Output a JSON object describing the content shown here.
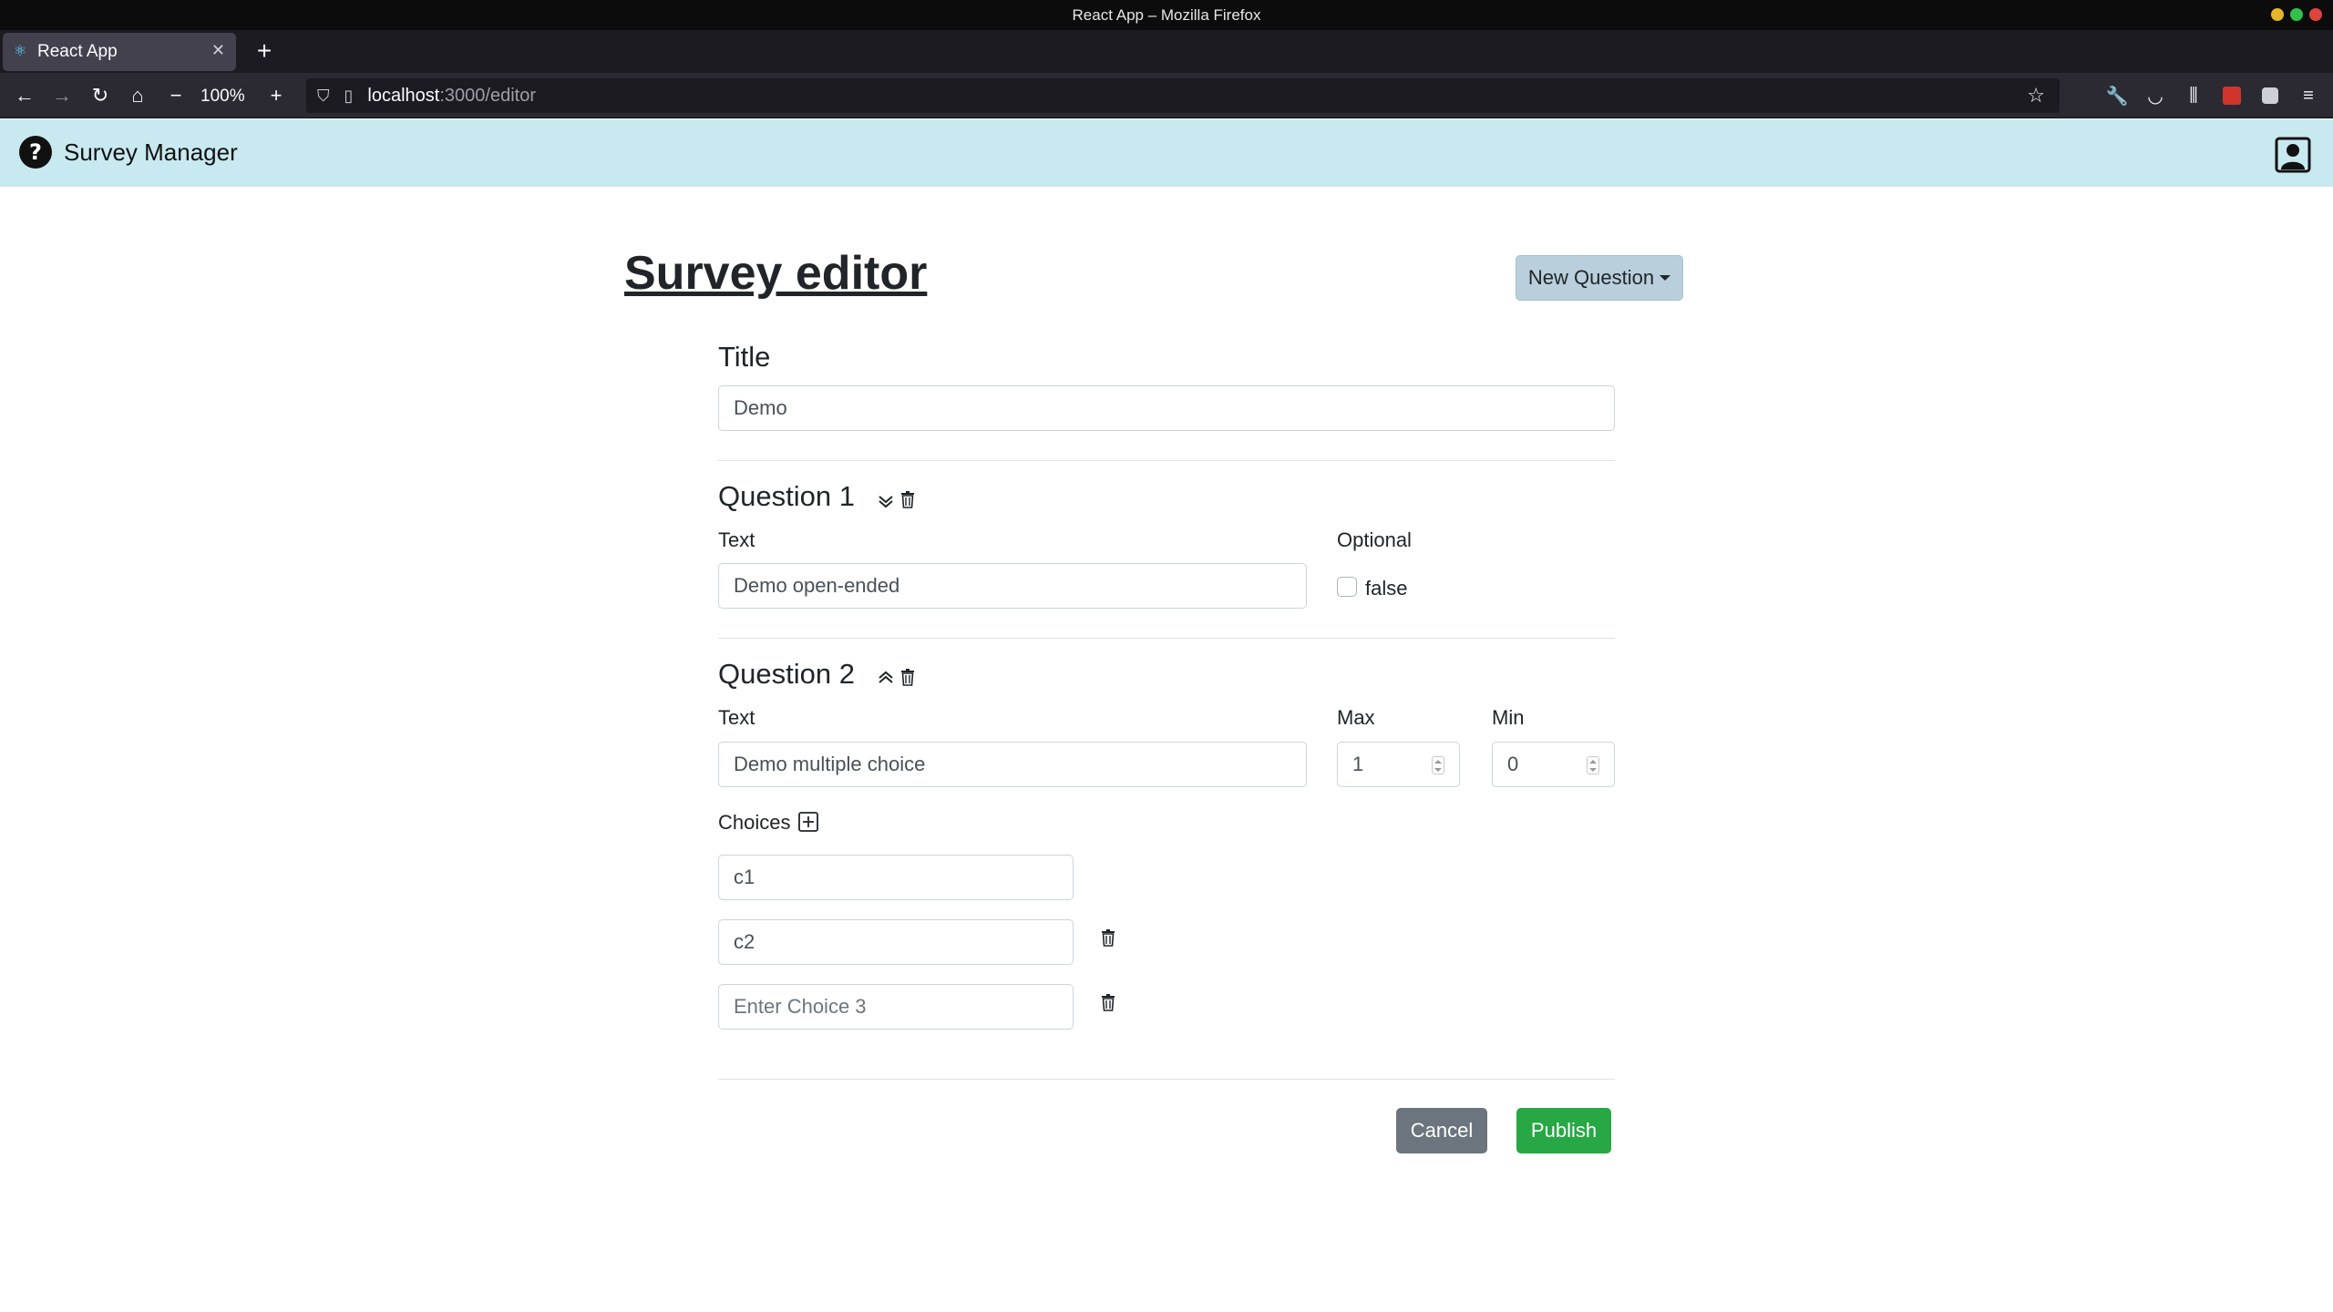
{
  "window": {
    "title": "React App – Mozilla Firefox"
  },
  "browser": {
    "tab_title": "React App",
    "zoom": "100%",
    "url_host": "localhost",
    "url_path": ":3000/editor"
  },
  "app": {
    "brand": "Survey Manager"
  },
  "editor": {
    "heading": "Survey editor",
    "new_question_label": "New Question",
    "title_label": "Title",
    "title_value": "Demo",
    "questions": [
      {
        "heading": "Question 1",
        "text_label": "Text",
        "text_value": "Demo open-ended",
        "optional_label": "Optional",
        "optional_text": "false"
      },
      {
        "heading": "Question 2",
        "text_label": "Text",
        "text_value": "Demo multiple choice",
        "max_label": "Max",
        "max_value": "1",
        "min_label": "Min",
        "min_value": "0",
        "choices_label": "Choices",
        "choices": [
          {
            "value": "c1",
            "placeholder": ""
          },
          {
            "value": "c2",
            "placeholder": ""
          },
          {
            "value": "",
            "placeholder": "Enter Choice 3"
          }
        ]
      }
    ],
    "cancel_label": "Cancel",
    "publish_label": "Publish"
  },
  "colors": {
    "appbar": "#c9e9f0",
    "new_question_button": "#b9cfdc",
    "cancel_button": "#6c757d",
    "publish_button": "#28a745"
  },
  "icons": {
    "brand": "question-circle-icon",
    "user": "person-square-icon",
    "move_down": "chevron-double-down-icon",
    "move_up": "chevron-double-up-icon",
    "delete": "trash-icon",
    "add_choice": "plus-square-icon"
  }
}
